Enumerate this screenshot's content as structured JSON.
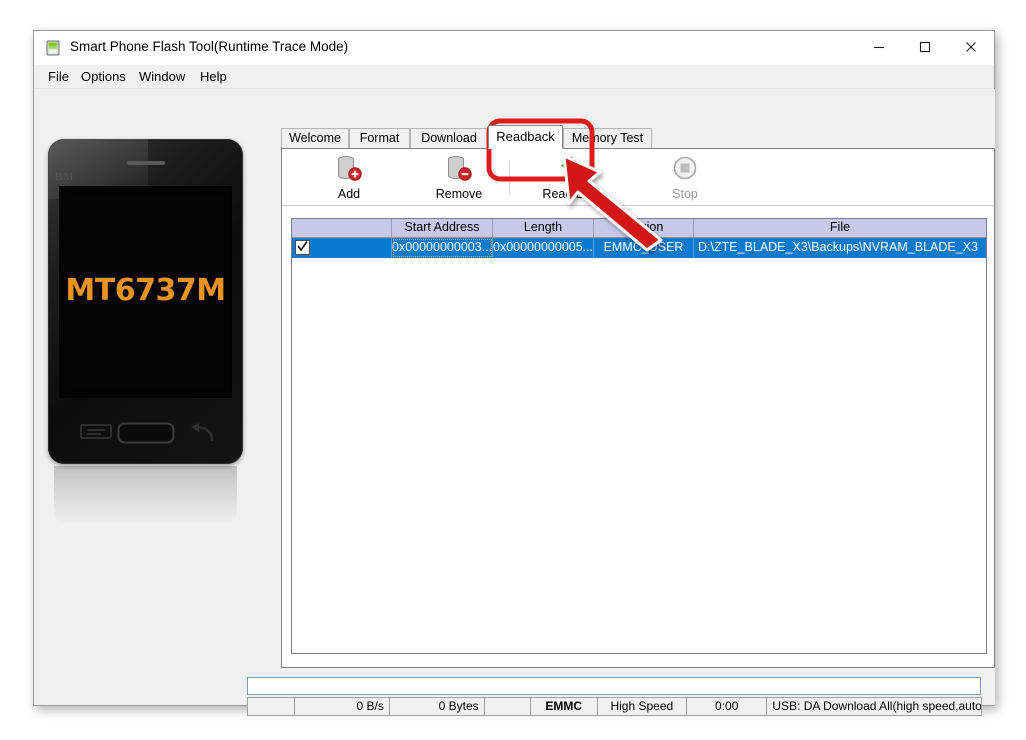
{
  "window": {
    "title": "Smart Phone Flash Tool(Runtime Trace Mode)",
    "icon": "flash-tool-icon",
    "minimize_label": "—",
    "maximize_label": "□",
    "close_label": "✕"
  },
  "menubar": {
    "items": [
      {
        "label": "File"
      },
      {
        "label": "Options"
      },
      {
        "label": "Window"
      },
      {
        "label": "Help"
      }
    ]
  },
  "device_panel": {
    "watermark": "BM",
    "chipset": "MT6737M",
    "nav_buttons": [
      "menu-button",
      "home-button",
      "back-button"
    ]
  },
  "tabs": [
    {
      "label": "Welcome",
      "active": false
    },
    {
      "label": "Format",
      "active": false
    },
    {
      "label": "Download",
      "active": false
    },
    {
      "label": "Readback",
      "active": true
    },
    {
      "label": "Memory Test",
      "active": false
    }
  ],
  "toolbar": {
    "buttons": [
      {
        "label": "Add",
        "icon": "add-disk-icon",
        "disabled": false
      },
      {
        "label": "Remove",
        "icon": "remove-disk-icon",
        "disabled": false
      },
      {
        "label": "Read Back",
        "icon": "read-back-arrow-icon",
        "disabled": false
      },
      {
        "label": "Stop",
        "icon": "stop-icon",
        "disabled": true
      }
    ]
  },
  "grid": {
    "columns": [
      "",
      "Start Address",
      "Length",
      "Region",
      "File"
    ],
    "rows": [
      {
        "checked": true,
        "start_address": "0x00000000003...",
        "length": "0x00000000005...",
        "region": "EMMC_USER",
        "file": "D:\\ZTE_BLADE_X3\\Backups\\NVRAM_BLADE_X3"
      }
    ]
  },
  "progress": {
    "value": 0
  },
  "statusbar": {
    "speed": "0 B/s",
    "bytes": "0 Bytes",
    "blank": "",
    "storage": "EMMC",
    "usb_speed": "High Speed",
    "elapsed": "0:00",
    "connection": "USB: DA Download All(high speed,auto detect)"
  },
  "annotation": {
    "highlight_target": "Read Back",
    "highlight_color": "#e01b1b",
    "arrow": "pointer-arrow"
  }
}
